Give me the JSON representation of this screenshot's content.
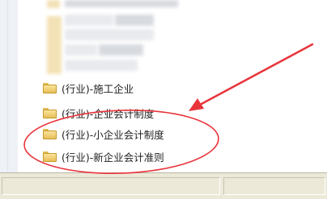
{
  "tree": {
    "items": [
      {
        "label": "(行业)-施工企业",
        "icon": "folder-icon"
      },
      {
        "label": "(行业)-企业会计制度",
        "icon": "folder-icon"
      },
      {
        "label": "(行业)-小企业会计制度",
        "icon": "folder-icon"
      },
      {
        "label": "(行业)-新企业会计准则",
        "icon": "folder-icon"
      }
    ]
  },
  "colors": {
    "annotation": "#e8343b",
    "folder": "#f2cd6d",
    "status_bar": "#ece9d8"
  }
}
